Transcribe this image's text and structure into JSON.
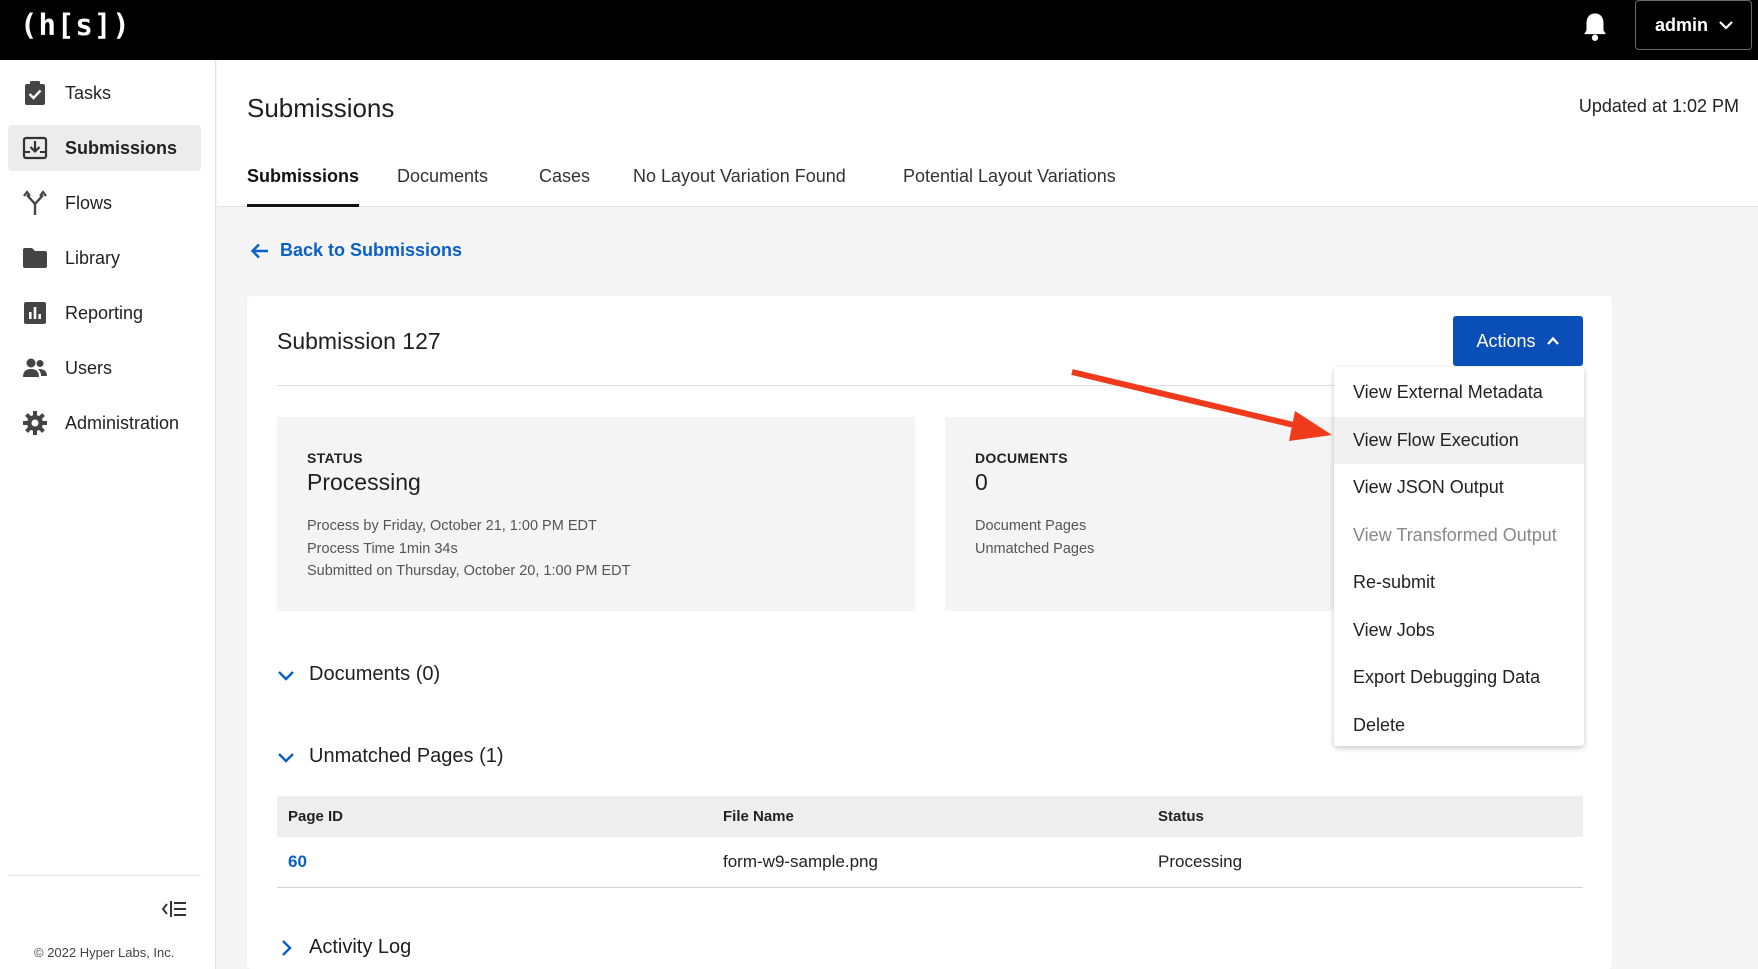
{
  "app": {
    "logo": "(h[s])",
    "user": "admin"
  },
  "sidebar": {
    "items": [
      {
        "label": "Tasks",
        "icon": "clipboard-check-icon"
      },
      {
        "label": "Submissions",
        "icon": "inbox-download-icon"
      },
      {
        "label": "Flows",
        "icon": "flow-fork-icon"
      },
      {
        "label": "Library",
        "icon": "folder-icon"
      },
      {
        "label": "Reporting",
        "icon": "bar-chart-icon"
      },
      {
        "label": "Users",
        "icon": "users-icon"
      },
      {
        "label": "Administration",
        "icon": "gear-icon"
      }
    ],
    "active": "Submissions",
    "copyright": "© 2022 Hyper Labs, Inc."
  },
  "header": {
    "title": "Submissions",
    "updated": "Updated at 1:02 PM",
    "tabs": [
      "Submissions",
      "Documents",
      "Cases",
      "No Layout Variation Found",
      "Potential Layout Variations"
    ],
    "active_tab": "Submissions"
  },
  "back_link": "Back to Submissions",
  "submission": {
    "title": "Submission 127",
    "actions_label": "Actions",
    "status": {
      "label": "STATUS",
      "value": "Processing",
      "lines": [
        "Process by Friday, October 21, 1:00 PM EDT",
        "Process Time 1min 34s",
        "Submitted on Thursday, October 20, 1:00 PM EDT"
      ]
    },
    "documents": {
      "label": "DOCUMENTS",
      "value": "0",
      "lines": [
        "Document Pages",
        "Unmatched Pages"
      ]
    },
    "sections": {
      "documents": "Documents (0)",
      "unmatched": "Unmatched Pages (1)",
      "activity": "Activity Log"
    },
    "table": {
      "columns": [
        "Page ID",
        "File Name",
        "Status"
      ],
      "rows": [
        [
          "60",
          "form-w9-sample.png",
          "Processing"
        ]
      ]
    }
  },
  "actions_menu": [
    "View External Metadata",
    "View Flow Execution",
    "View JSON Output",
    "View Transformed Output",
    "Re-submit",
    "View Jobs",
    "Export Debugging Data",
    "Delete"
  ],
  "colors": {
    "primary": "#0a4fb8",
    "link": "#0a5fc9",
    "topbar": "#000000",
    "annotation_arrow": "#f03a1c"
  }
}
